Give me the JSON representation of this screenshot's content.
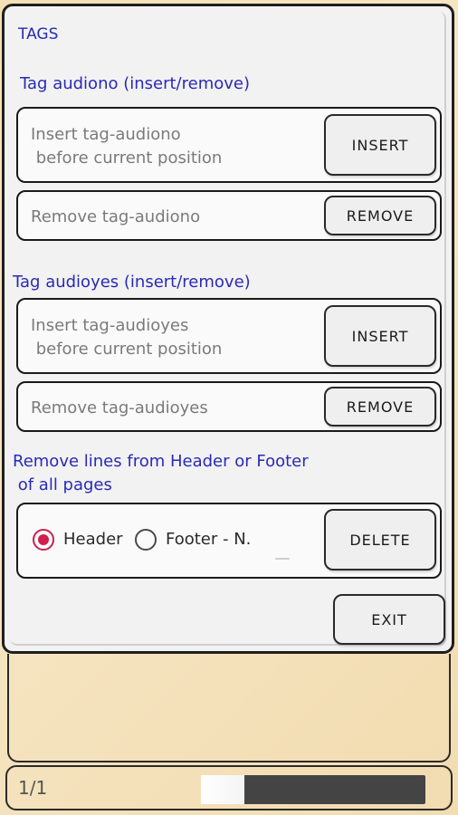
{
  "dialog": {
    "title": "TAGS",
    "section1": {
      "label": "Tag audiono (insert/remove)",
      "insert_text": "Insert tag-audiono\n before current position",
      "insert_button": "INSERT",
      "remove_text": "Remove tag-audiono",
      "remove_button": "REMOVE"
    },
    "section2": {
      "label": "Tag audioyes (insert/remove)",
      "insert_text": "Insert tag-audioyes\n before current position",
      "insert_button": "INSERT",
      "remove_text": "Remove tag-audioyes",
      "remove_button": "REMOVE"
    },
    "section3": {
      "label_line1": "Remove lines from Header or Footer",
      "label_line2": " of all pages",
      "radio_header": "Header",
      "radio_footer": "Footer - N.",
      "selected": "header",
      "delete_button": "DELETE"
    },
    "exit_button": "EXIT"
  },
  "bottom": {
    "page_indicator": "1/1",
    "slider_position": 0.0
  },
  "colors": {
    "accent_blue": "#2a2ab8",
    "radio_selected": "#d01e4e"
  }
}
